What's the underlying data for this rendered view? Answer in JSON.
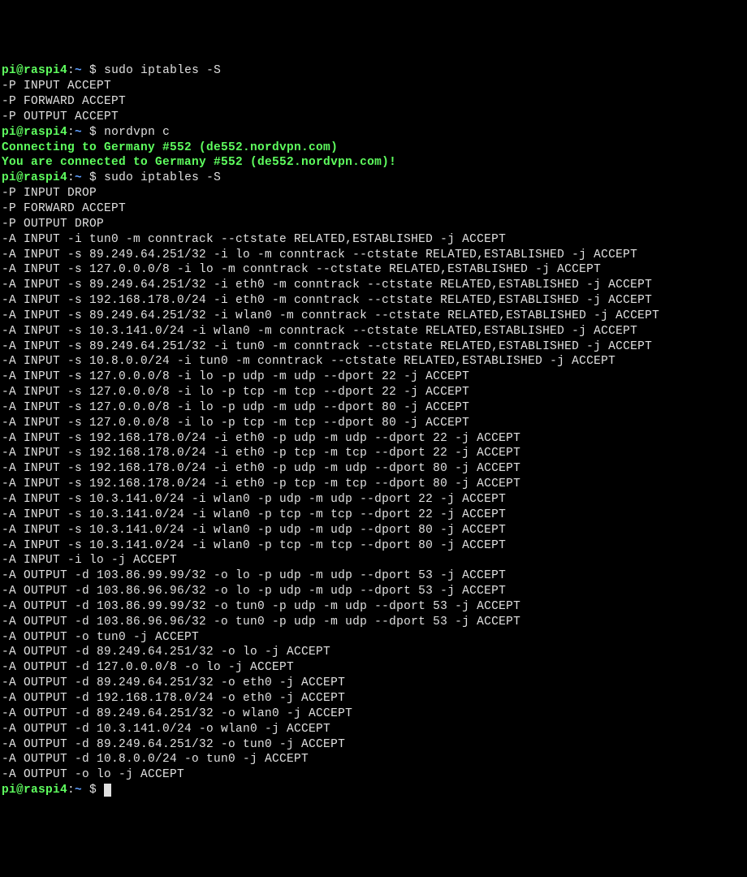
{
  "prompt": {
    "user": "pi",
    "host": "raspi4",
    "path": "~",
    "symbol": "$"
  },
  "entries": [
    {
      "type": "prompt",
      "command": "sudo iptables -S"
    },
    {
      "type": "output",
      "lines": [
        "-P INPUT ACCEPT",
        "-P FORWARD ACCEPT",
        "-P OUTPUT ACCEPT"
      ]
    },
    {
      "type": "prompt",
      "command": "nordvpn c"
    },
    {
      "type": "vpn",
      "lines": [
        "Connecting to Germany #552 (de552.nordvpn.com)",
        "You are connected to Germany #552 (de552.nordvpn.com)!"
      ]
    },
    {
      "type": "prompt",
      "command": "sudo iptables -S"
    },
    {
      "type": "output",
      "lines": [
        "-P INPUT DROP",
        "-P FORWARD ACCEPT",
        "-P OUTPUT DROP",
        "-A INPUT -i tun0 -m conntrack --ctstate RELATED,ESTABLISHED -j ACCEPT",
        "-A INPUT -s 89.249.64.251/32 -i lo -m conntrack --ctstate RELATED,ESTABLISHED -j ACCEPT",
        "-A INPUT -s 127.0.0.0/8 -i lo -m conntrack --ctstate RELATED,ESTABLISHED -j ACCEPT",
        "-A INPUT -s 89.249.64.251/32 -i eth0 -m conntrack --ctstate RELATED,ESTABLISHED -j ACCEPT",
        "-A INPUT -s 192.168.178.0/24 -i eth0 -m conntrack --ctstate RELATED,ESTABLISHED -j ACCEPT",
        "-A INPUT -s 89.249.64.251/32 -i wlan0 -m conntrack --ctstate RELATED,ESTABLISHED -j ACCEPT",
        "-A INPUT -s 10.3.141.0/24 -i wlan0 -m conntrack --ctstate RELATED,ESTABLISHED -j ACCEPT",
        "-A INPUT -s 89.249.64.251/32 -i tun0 -m conntrack --ctstate RELATED,ESTABLISHED -j ACCEPT",
        "-A INPUT -s 10.8.0.0/24 -i tun0 -m conntrack --ctstate RELATED,ESTABLISHED -j ACCEPT",
        "-A INPUT -s 127.0.0.0/8 -i lo -p udp -m udp --dport 22 -j ACCEPT",
        "-A INPUT -s 127.0.0.0/8 -i lo -p tcp -m tcp --dport 22 -j ACCEPT",
        "-A INPUT -s 127.0.0.0/8 -i lo -p udp -m udp --dport 80 -j ACCEPT",
        "-A INPUT -s 127.0.0.0/8 -i lo -p tcp -m tcp --dport 80 -j ACCEPT",
        "-A INPUT -s 192.168.178.0/24 -i eth0 -p udp -m udp --dport 22 -j ACCEPT",
        "-A INPUT -s 192.168.178.0/24 -i eth0 -p tcp -m tcp --dport 22 -j ACCEPT",
        "-A INPUT -s 192.168.178.0/24 -i eth0 -p udp -m udp --dport 80 -j ACCEPT",
        "-A INPUT -s 192.168.178.0/24 -i eth0 -p tcp -m tcp --dport 80 -j ACCEPT",
        "-A INPUT -s 10.3.141.0/24 -i wlan0 -p udp -m udp --dport 22 -j ACCEPT",
        "-A INPUT -s 10.3.141.0/24 -i wlan0 -p tcp -m tcp --dport 22 -j ACCEPT",
        "-A INPUT -s 10.3.141.0/24 -i wlan0 -p udp -m udp --dport 80 -j ACCEPT",
        "-A INPUT -s 10.3.141.0/24 -i wlan0 -p tcp -m tcp --dport 80 -j ACCEPT",
        "-A INPUT -i lo -j ACCEPT",
        "-A OUTPUT -d 103.86.99.99/32 -o lo -p udp -m udp --dport 53 -j ACCEPT",
        "-A OUTPUT -d 103.86.96.96/32 -o lo -p udp -m udp --dport 53 -j ACCEPT",
        "-A OUTPUT -d 103.86.99.99/32 -o tun0 -p udp -m udp --dport 53 -j ACCEPT",
        "-A OUTPUT -d 103.86.96.96/32 -o tun0 -p udp -m udp --dport 53 -j ACCEPT",
        "-A OUTPUT -o tun0 -j ACCEPT",
        "-A OUTPUT -d 89.249.64.251/32 -o lo -j ACCEPT",
        "-A OUTPUT -d 127.0.0.0/8 -o lo -j ACCEPT",
        "-A OUTPUT -d 89.249.64.251/32 -o eth0 -j ACCEPT",
        "-A OUTPUT -d 192.168.178.0/24 -o eth0 -j ACCEPT",
        "-A OUTPUT -d 89.249.64.251/32 -o wlan0 -j ACCEPT",
        "-A OUTPUT -d 10.3.141.0/24 -o wlan0 -j ACCEPT",
        "-A OUTPUT -d 89.249.64.251/32 -o tun0 -j ACCEPT",
        "-A OUTPUT -d 10.8.0.0/24 -o tun0 -j ACCEPT",
        "-A OUTPUT -o lo -j ACCEPT"
      ]
    },
    {
      "type": "prompt",
      "command": "",
      "cursor": true
    }
  ]
}
